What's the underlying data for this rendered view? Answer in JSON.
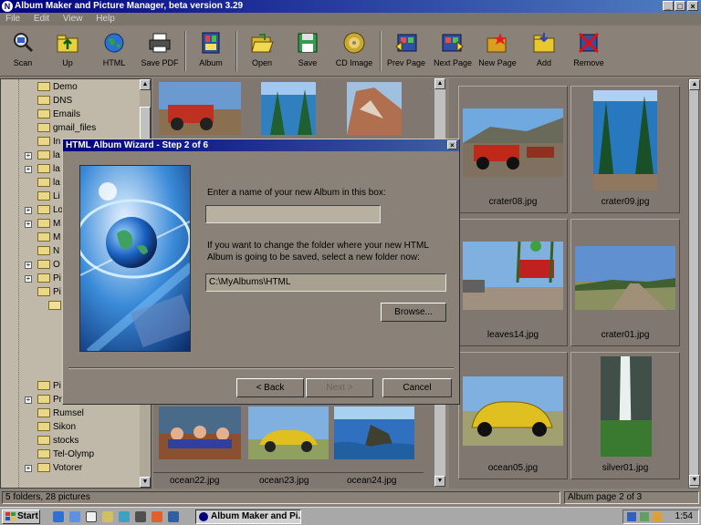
{
  "window": {
    "title": "Album Maker and Picture Manager, beta version 3.29",
    "min": "_",
    "max": "□",
    "close": "×"
  },
  "menu": [
    "File",
    "Edit",
    "View",
    "Help"
  ],
  "toolbar": [
    {
      "label": "Scan",
      "icon": "scan-icon"
    },
    {
      "label": "Up",
      "icon": "up-folder-icon"
    },
    {
      "label": "HTML",
      "icon": "globe-icon"
    },
    {
      "label": "Save PDF",
      "icon": "printer-icon"
    },
    {
      "label": "Album",
      "icon": "album-icon"
    },
    {
      "label": "Open",
      "icon": "open-folder-icon"
    },
    {
      "label": "Save",
      "icon": "floppy-disk-icon"
    },
    {
      "label": "CD Image",
      "icon": "cd-icon"
    },
    {
      "label": "Prev Page",
      "icon": "prev-page-icon"
    },
    {
      "label": "Next Page",
      "icon": "next-page-icon"
    },
    {
      "label": "New Page",
      "icon": "new-page-icon"
    },
    {
      "label": "Add",
      "icon": "add-folder-icon"
    },
    {
      "label": "Remove",
      "icon": "remove-icon"
    }
  ],
  "tree": {
    "items_top": [
      "Demo",
      "DNS",
      "Emails",
      "gmail_files",
      "In",
      "la",
      "la",
      "la",
      "Li",
      "Lo",
      "M",
      "M",
      "N",
      "O",
      "Pi",
      "Pi"
    ],
    "items_bottom": [
      "Pi",
      "Pr",
      "Rumsel",
      "Sikon",
      "stocks",
      "Tel-Olymp",
      "Votorer"
    ]
  },
  "center_thumbs": [
    {
      "caption": "ocean22.jpg"
    },
    {
      "caption": "ocean23.jpg"
    },
    {
      "caption": "ocean24.jpg"
    }
  ],
  "right_thumbs": [
    {
      "caption": "crater08.jpg"
    },
    {
      "caption": "crater09.jpg"
    },
    {
      "caption": "leaves14.jpg"
    },
    {
      "caption": "crater01.jpg"
    },
    {
      "caption": "ocean05.jpg"
    },
    {
      "caption": "silver01.jpg"
    }
  ],
  "dialog": {
    "title": "HTML Album Wizard - Step 2 of 6",
    "name_prompt": "Enter a name of your new Album in this box:",
    "name_value": "",
    "folder_prompt": "If you want to change the folder where your new HTML Album is going to be saved, select a new folder now:",
    "folder_value": "C:\\MyAlbums\\HTML",
    "browse": "Browse...",
    "back": "< Back",
    "next": "Next >",
    "cancel": "Cancel"
  },
  "status": {
    "left": "5 folders, 28 pictures",
    "right": "Album page 2 of 3"
  },
  "taskbar": {
    "start": "Start",
    "app": "Album Maker and Pi...",
    "clock": "1:54"
  }
}
